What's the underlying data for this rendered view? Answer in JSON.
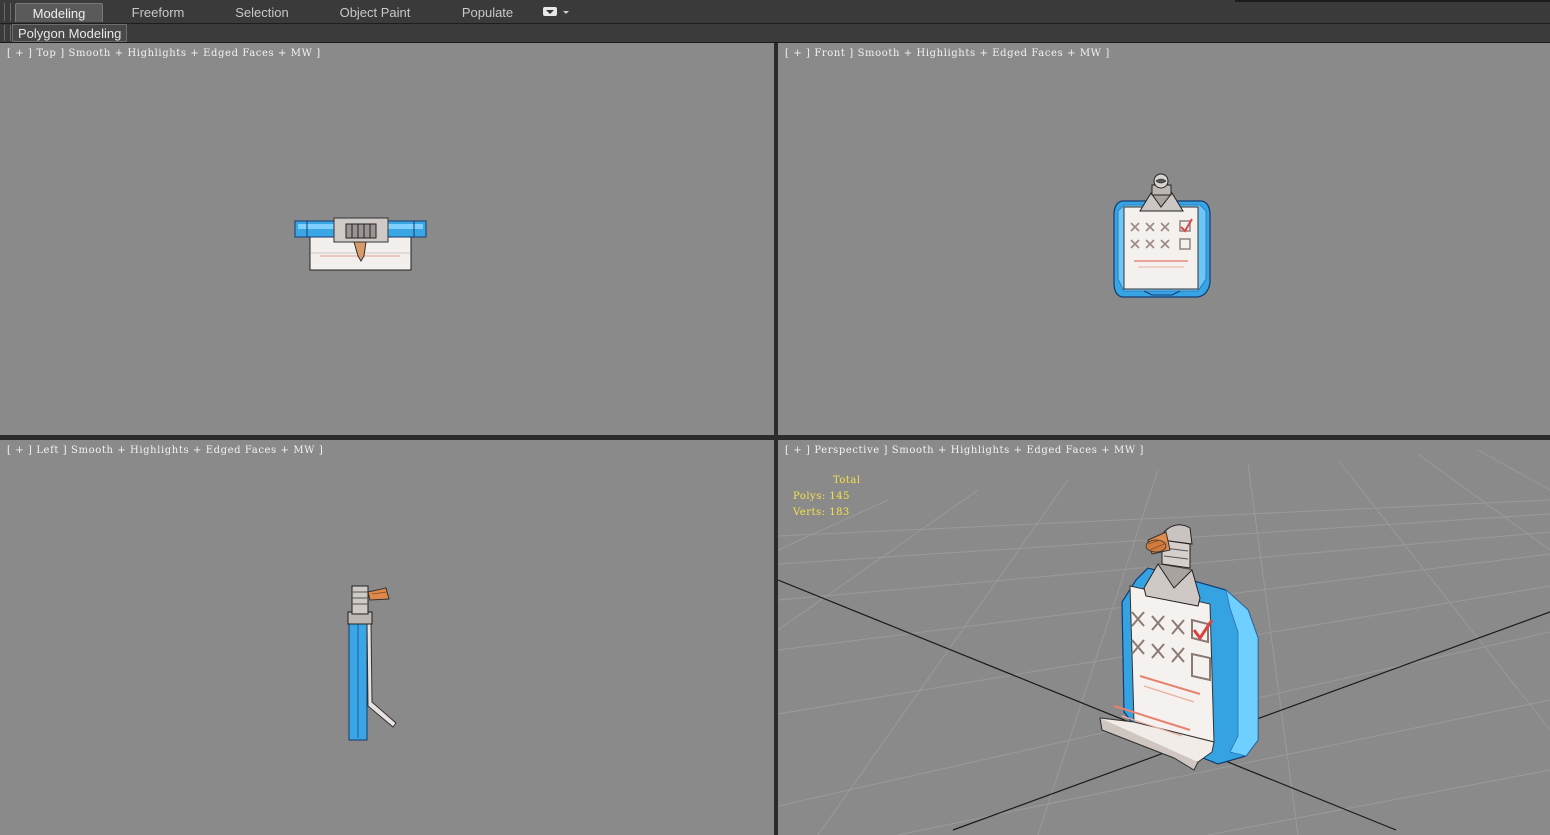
{
  "ribbon": {
    "tabs": [
      {
        "label": "Modeling",
        "active": true
      },
      {
        "label": "Freeform",
        "active": false
      },
      {
        "label": "Selection",
        "active": false
      },
      {
        "label": "Object Paint",
        "active": false
      },
      {
        "label": "Populate",
        "active": false
      }
    ],
    "panel_label": "Polygon Modeling"
  },
  "viewports": {
    "top": {
      "label": "[ + ] Top ] Smooth + Highlights + Edged Faces + MW ]"
    },
    "front": {
      "label": "[ + ] Front ] Smooth + Highlights + Edged Faces + MW ]"
    },
    "left": {
      "label": "[ + ] Left ] Smooth + Highlights + Edged Faces + MW ]"
    },
    "perspective": {
      "label": "[ + ] Perspective ] Smooth + Highlights + Edged Faces + MW ]",
      "stats": {
        "header": "Total",
        "polys": "Polys: 145",
        "verts": "Verts: 183"
      }
    }
  },
  "colors": {
    "viewport_bg": "#8a8a8a",
    "clipboard_blue": "#2f9fe0",
    "paper": "#f4f0ee",
    "stats_text": "#f3e24a",
    "check_red": "#d94a4a"
  }
}
